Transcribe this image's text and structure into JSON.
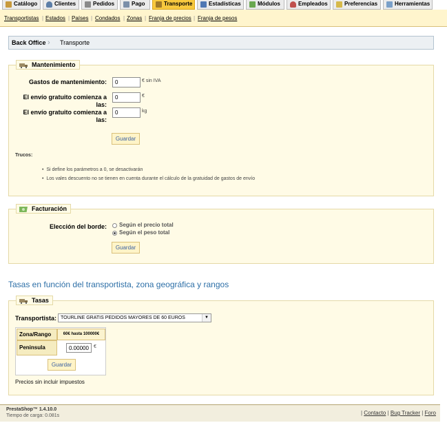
{
  "tabs": [
    {
      "label": "Catálogo",
      "icon": "catalog-icon",
      "color": "#c89a3c"
    },
    {
      "label": "Clientes",
      "icon": "customers-icon",
      "color": "#5d7fa8"
    },
    {
      "label": "Pedidos",
      "icon": "orders-icon",
      "color": "#8a8a8a"
    },
    {
      "label": "Pago",
      "icon": "payment-icon",
      "color": "#7b8fa9"
    },
    {
      "label": "Transporte",
      "icon": "truck-icon",
      "color": "#a07a28"
    },
    {
      "label": "Estadísticas",
      "icon": "stats-icon",
      "color": "#4f78b4"
    },
    {
      "label": "Módulos",
      "icon": "modules-icon",
      "color": "#6aa84f"
    },
    {
      "label": "Empleados",
      "icon": "employees-icon",
      "color": "#c0504d"
    },
    {
      "label": "Preferencias",
      "icon": "preferences-icon",
      "color": "#d6b94a"
    },
    {
      "label": "Herramientas",
      "icon": "tools-icon",
      "color": "#7aa0c9"
    }
  ],
  "active_tab": "Transporte",
  "subtabs": [
    "Transportistas",
    "Estados",
    "Países",
    "Condados",
    "Zonas",
    "Franja de precios",
    "Franja de pesos"
  ],
  "breadcrumb": {
    "root": "Back Office",
    "current": "Transporte"
  },
  "maintenance": {
    "legend": "Mantenimiento",
    "handling_label": "Gastos de mantenimiento:",
    "handling_value": "0",
    "handling_suffix": "€ sin IVA",
    "free_price_label": "El envío gratuito comienza a las:",
    "free_price_value": "0",
    "free_price_suffix": "€",
    "free_weight_label": "El envío gratuito comienza a las:",
    "free_weight_value": "0",
    "free_weight_suffix": "kg",
    "save": "Guardar",
    "tips_title": "Trucos:",
    "tips": [
      "Si define los parámetros a 0, se desactivarán",
      "Los vales descuento no se tienen en cuenta durante el cálculo de la gratuidad de gastos de envío"
    ]
  },
  "billing": {
    "legend": "Facturación",
    "label": "Elección del borde:",
    "options": [
      "Según el precio total",
      "Según el peso total"
    ],
    "selected": 1,
    "save": "Guardar"
  },
  "rates_title": "Tasas en función del transportista, zona geográfica y rangos",
  "rates": {
    "legend": "Tasas",
    "carrier_label": "Transportista:",
    "carrier_value": "TOURLINE GRATIS PEDIDOS MAYORES DE 60 EUROS",
    "zone_range_header": "Zona/Rango",
    "range_header": "60€ hasta 100000€",
    "zone": "Peninsula",
    "price": "0.00000",
    "price_suffix": "€",
    "save": "Guardar",
    "note": "Precios sin incluir impuestos"
  },
  "footer": {
    "version": "PrestaShop™ 1.4.10.0",
    "load_time": "Tiempo de carga: 0.081s",
    "links": [
      "Contacto",
      "Bug Tracker",
      "Foro"
    ]
  },
  "colors": {
    "accent": "#f8c93e",
    "link": "#2d6fa7",
    "panel_bg": "#fffbe6",
    "panel_border": "#e4d9a6"
  }
}
